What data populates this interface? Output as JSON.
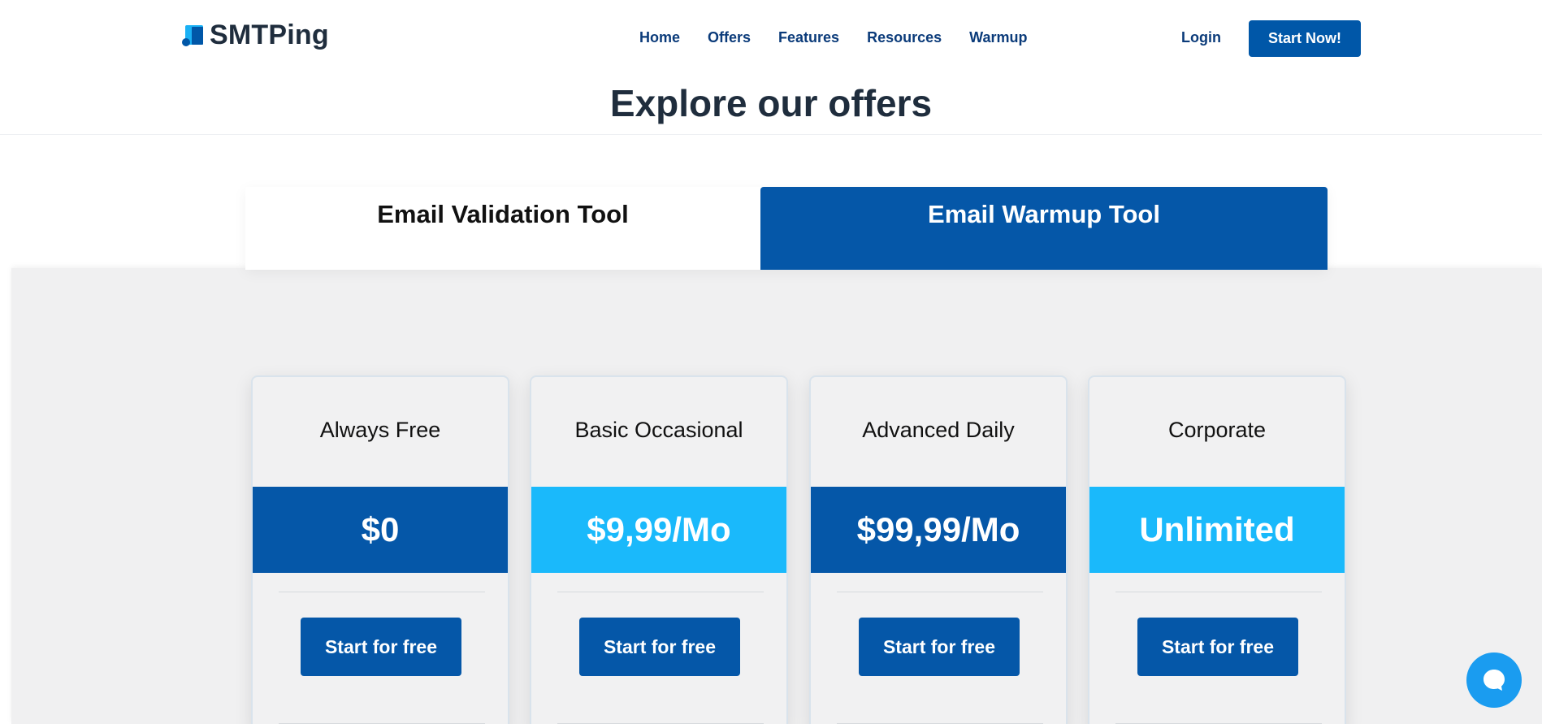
{
  "header": {
    "logo_text": "SMTPing",
    "nav": [
      "Home",
      "Offers",
      "Features",
      "Resources",
      "Warmup"
    ],
    "login_label": "Login",
    "cta_label": "Start Now!"
  },
  "page_title": "Explore our offers",
  "tabs": [
    {
      "label": "Email Validation Tool",
      "active": false
    },
    {
      "label": "Email Warmup Tool",
      "active": true
    }
  ],
  "plans": [
    {
      "name": "Always Free",
      "price": "$0",
      "button": "Start for free"
    },
    {
      "name": "Basic Occasional",
      "price": "$9,99/Mo",
      "button": "Start for free"
    },
    {
      "name": "Advanced Daily",
      "price": "$99,99/Mo",
      "button": "Start for free"
    },
    {
      "name": "Corporate",
      "price": "Unlimited",
      "button": "Start for free"
    }
  ],
  "colors": {
    "primary": "#0557a8",
    "accent": "#1ab9fb",
    "heading": "#1f2d3d",
    "nav_text": "#0b3b7a",
    "section_bg": "#f0f0f1",
    "chat": "#1a9cf0"
  },
  "chat_widget_icon": "chat-bubble-icon"
}
